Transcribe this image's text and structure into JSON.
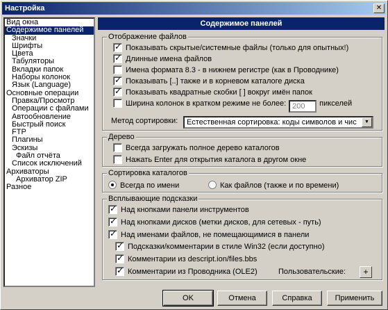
{
  "window": {
    "title": "Настройка"
  },
  "tree": [
    {
      "label": "Вид окна",
      "level": 0,
      "selected": false
    },
    {
      "label": "Содержимое панелей",
      "level": 0,
      "selected": true
    },
    {
      "label": "Значки",
      "level": 1,
      "selected": false
    },
    {
      "label": "Шрифты",
      "level": 1,
      "selected": false
    },
    {
      "label": "Цвета",
      "level": 1,
      "selected": false
    },
    {
      "label": "Табуляторы",
      "level": 1,
      "selected": false
    },
    {
      "label": "Вкладки папок",
      "level": 1,
      "selected": false
    },
    {
      "label": "Наборы колонок",
      "level": 1,
      "selected": false
    },
    {
      "label": "Язык (Language)",
      "level": 1,
      "selected": false
    },
    {
      "label": "Основные операции",
      "level": 0,
      "selected": false
    },
    {
      "label": "Правка/Просмотр",
      "level": 1,
      "selected": false
    },
    {
      "label": "Операции с файлами",
      "level": 1,
      "selected": false
    },
    {
      "label": "Автообновление",
      "level": 1,
      "selected": false
    },
    {
      "label": "Быстрый поиск",
      "level": 1,
      "selected": false
    },
    {
      "label": "FTP",
      "level": 1,
      "selected": false
    },
    {
      "label": "Плагины",
      "level": 1,
      "selected": false
    },
    {
      "label": "Эскизы",
      "level": 1,
      "selected": false
    },
    {
      "label": "Файл отчёта",
      "level": 2,
      "selected": false
    },
    {
      "label": "Список исключений",
      "level": 1,
      "selected": false
    },
    {
      "label": "Архиваторы",
      "level": 0,
      "selected": false
    },
    {
      "label": "Архиватор ZIP",
      "level": 2,
      "selected": false
    },
    {
      "label": "Разное",
      "level": 0,
      "selected": false
    }
  ],
  "panel": {
    "title": "Содержимое панелей"
  },
  "file_display": {
    "title": "Отображение файлов",
    "options": [
      {
        "label": "Показывать скрытые/системные файлы (только для опытных!)",
        "checked": true
      },
      {
        "label": "Длинные имена файлов",
        "checked": true
      },
      {
        "label": "Имена формата 8.3 - в нижнем регистре (как в Проводнике)",
        "checked": false
      },
      {
        "label": "Показывать [..] также и в корневом каталоге диска",
        "checked": true
      },
      {
        "label": "Показывать квадратные скобки [ ] вокруг имён папок",
        "checked": true
      }
    ],
    "width_label": "Ширина колонок в кратком режиме не более:",
    "width_value": "200",
    "width_unit": "пикселей",
    "width_checked": false,
    "sort_label": "Метод сортировки:",
    "sort_value": "Естественная сортировка: коды символов и чис"
  },
  "tree_group": {
    "title": "Дерево",
    "options": [
      {
        "label": "Всегда загружать полное дерево каталогов",
        "checked": false
      },
      {
        "label": "Нажать Enter для открытия каталога в другом окне",
        "checked": false
      }
    ]
  },
  "dir_sort": {
    "title": "Сортировка каталогов",
    "option_name": "Всегда по имени",
    "option_files": "Как файлов (также и по времени)"
  },
  "tooltips": {
    "title": "Всплывающие подсказки",
    "options": [
      {
        "label": "Над кнопками панели инструментов",
        "checked": true
      },
      {
        "label": "Над кнопками дисков (метки дисков, для сетевых - путь)",
        "checked": true
      },
      {
        "label": "Над именами файлов, не помещающимися в панели",
        "checked": true
      }
    ],
    "sub_options": [
      {
        "label": "Подсказки/комментарии в стиле Win32 (если доступно)",
        "checked": true
      },
      {
        "label": "Комментарии из descript.ion/files.bbs",
        "checked": true
      },
      {
        "label": "Комментарии из Проводника (OLE2)",
        "checked": true
      }
    ],
    "custom_label": "Пользовательские:",
    "add_button": "+"
  },
  "buttons": {
    "ok": "OK",
    "cancel": "Отмена",
    "help": "Справка",
    "apply": "Применить"
  }
}
